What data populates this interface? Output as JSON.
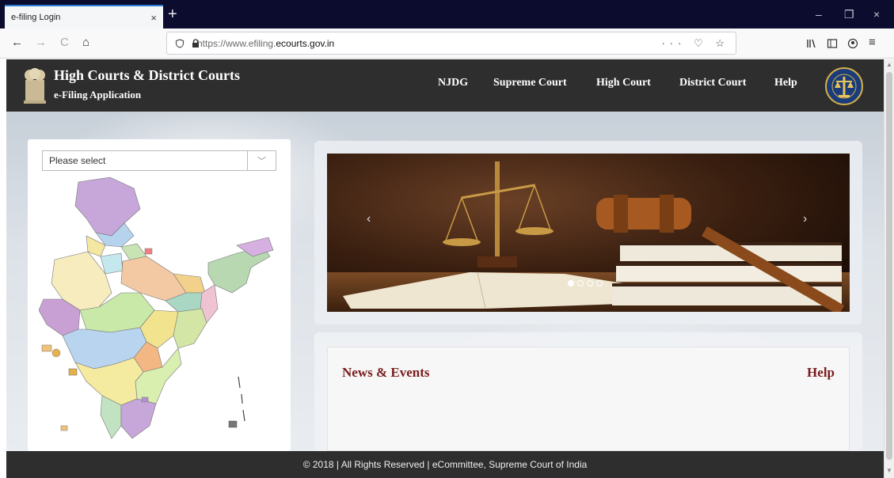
{
  "browser": {
    "tab_title": "e-filing Login",
    "tab_close": "×",
    "new_tab": "+",
    "url_prefix": "https://www.efiling.",
    "url_domain": "ecourts.gov.in",
    "url_icons": "··· ♡ ☆",
    "back": "←",
    "forward": "→",
    "reload": "C",
    "home": "⌂",
    "minimize": "–",
    "restore": "❐",
    "close": "×",
    "menu": "≡"
  },
  "header": {
    "title": "High Courts & District Courts",
    "subtitle": "e-Filing Application",
    "nav": [
      "NJDG",
      "Supreme Court",
      "High Court",
      "District Court",
      "Help"
    ]
  },
  "map_panel": {
    "select_value": "Please select",
    "select_caret": "﹀",
    "states": [
      "Jammu and Kashmir",
      "Himachal Pradesh",
      "Punjab",
      "Uttarakhand",
      "Haryana",
      "Delhi",
      "Uttar Pradesh",
      "Rajasthan",
      "Sikkim",
      "Arunachal Pradesh",
      "Assam",
      "Meghalaya",
      "Nagaland",
      "Bihar",
      "Gujarat",
      "Madhya Pradesh",
      "Jharkhand",
      "West Bengal",
      "Tripura",
      "Mizoram",
      "Chhattisgarh",
      "Odisha",
      "Daman and Diu",
      "Dadra and Nagar Haveli",
      "Maharashtra",
      "Telangana",
      "Goa",
      "Karnataka",
      "Andhra Pradesh",
      "Puducherry",
      "Tamil Nadu",
      "Kerala",
      "Lakshadweep",
      "Andaman and Nicobar Islands"
    ]
  },
  "slider": {
    "prev": "‹",
    "next": "›",
    "dot_count": 4,
    "active_dot": 0
  },
  "news": {
    "title": "News & Events",
    "help": "Help"
  },
  "footer": {
    "text": "© 2018 | All Rights Reserved | eCommittee, Supreme Court of India"
  }
}
